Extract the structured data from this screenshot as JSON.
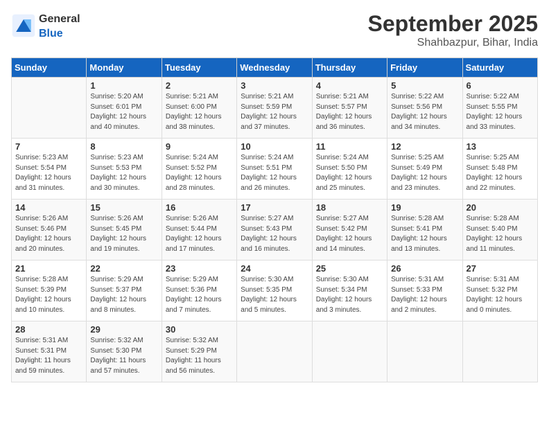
{
  "header": {
    "logo_general": "General",
    "logo_blue": "Blue",
    "month": "September 2025",
    "location": "Shahbazpur, Bihar, India"
  },
  "days_of_week": [
    "Sunday",
    "Monday",
    "Tuesday",
    "Wednesday",
    "Thursday",
    "Friday",
    "Saturday"
  ],
  "weeks": [
    [
      {
        "day": "",
        "sunrise": "",
        "sunset": "",
        "daylight": ""
      },
      {
        "day": "1",
        "sunrise": "5:20 AM",
        "sunset": "6:01 PM",
        "daylight": "12 hours and 40 minutes."
      },
      {
        "day": "2",
        "sunrise": "5:21 AM",
        "sunset": "6:00 PM",
        "daylight": "12 hours and 38 minutes."
      },
      {
        "day": "3",
        "sunrise": "5:21 AM",
        "sunset": "5:59 PM",
        "daylight": "12 hours and 37 minutes."
      },
      {
        "day": "4",
        "sunrise": "5:21 AM",
        "sunset": "5:57 PM",
        "daylight": "12 hours and 36 minutes."
      },
      {
        "day": "5",
        "sunrise": "5:22 AM",
        "sunset": "5:56 PM",
        "daylight": "12 hours and 34 minutes."
      },
      {
        "day": "6",
        "sunrise": "5:22 AM",
        "sunset": "5:55 PM",
        "daylight": "12 hours and 33 minutes."
      }
    ],
    [
      {
        "day": "7",
        "sunrise": "5:23 AM",
        "sunset": "5:54 PM",
        "daylight": "12 hours and 31 minutes."
      },
      {
        "day": "8",
        "sunrise": "5:23 AM",
        "sunset": "5:53 PM",
        "daylight": "12 hours and 30 minutes."
      },
      {
        "day": "9",
        "sunrise": "5:24 AM",
        "sunset": "5:52 PM",
        "daylight": "12 hours and 28 minutes."
      },
      {
        "day": "10",
        "sunrise": "5:24 AM",
        "sunset": "5:51 PM",
        "daylight": "12 hours and 26 minutes."
      },
      {
        "day": "11",
        "sunrise": "5:24 AM",
        "sunset": "5:50 PM",
        "daylight": "12 hours and 25 minutes."
      },
      {
        "day": "12",
        "sunrise": "5:25 AM",
        "sunset": "5:49 PM",
        "daylight": "12 hours and 23 minutes."
      },
      {
        "day": "13",
        "sunrise": "5:25 AM",
        "sunset": "5:48 PM",
        "daylight": "12 hours and 22 minutes."
      }
    ],
    [
      {
        "day": "14",
        "sunrise": "5:26 AM",
        "sunset": "5:46 PM",
        "daylight": "12 hours and 20 minutes."
      },
      {
        "day": "15",
        "sunrise": "5:26 AM",
        "sunset": "5:45 PM",
        "daylight": "12 hours and 19 minutes."
      },
      {
        "day": "16",
        "sunrise": "5:26 AM",
        "sunset": "5:44 PM",
        "daylight": "12 hours and 17 minutes."
      },
      {
        "day": "17",
        "sunrise": "5:27 AM",
        "sunset": "5:43 PM",
        "daylight": "12 hours and 16 minutes."
      },
      {
        "day": "18",
        "sunrise": "5:27 AM",
        "sunset": "5:42 PM",
        "daylight": "12 hours and 14 minutes."
      },
      {
        "day": "19",
        "sunrise": "5:28 AM",
        "sunset": "5:41 PM",
        "daylight": "12 hours and 13 minutes."
      },
      {
        "day": "20",
        "sunrise": "5:28 AM",
        "sunset": "5:40 PM",
        "daylight": "12 hours and 11 minutes."
      }
    ],
    [
      {
        "day": "21",
        "sunrise": "5:28 AM",
        "sunset": "5:39 PM",
        "daylight": "12 hours and 10 minutes."
      },
      {
        "day": "22",
        "sunrise": "5:29 AM",
        "sunset": "5:37 PM",
        "daylight": "12 hours and 8 minutes."
      },
      {
        "day": "23",
        "sunrise": "5:29 AM",
        "sunset": "5:36 PM",
        "daylight": "12 hours and 7 minutes."
      },
      {
        "day": "24",
        "sunrise": "5:30 AM",
        "sunset": "5:35 PM",
        "daylight": "12 hours and 5 minutes."
      },
      {
        "day": "25",
        "sunrise": "5:30 AM",
        "sunset": "5:34 PM",
        "daylight": "12 hours and 3 minutes."
      },
      {
        "day": "26",
        "sunrise": "5:31 AM",
        "sunset": "5:33 PM",
        "daylight": "12 hours and 2 minutes."
      },
      {
        "day": "27",
        "sunrise": "5:31 AM",
        "sunset": "5:32 PM",
        "daylight": "12 hours and 0 minutes."
      }
    ],
    [
      {
        "day": "28",
        "sunrise": "5:31 AM",
        "sunset": "5:31 PM",
        "daylight": "11 hours and 59 minutes."
      },
      {
        "day": "29",
        "sunrise": "5:32 AM",
        "sunset": "5:30 PM",
        "daylight": "11 hours and 57 minutes."
      },
      {
        "day": "30",
        "sunrise": "5:32 AM",
        "sunset": "5:29 PM",
        "daylight": "11 hours and 56 minutes."
      },
      {
        "day": "",
        "sunrise": "",
        "sunset": "",
        "daylight": ""
      },
      {
        "day": "",
        "sunrise": "",
        "sunset": "",
        "daylight": ""
      },
      {
        "day": "",
        "sunrise": "",
        "sunset": "",
        "daylight": ""
      },
      {
        "day": "",
        "sunrise": "",
        "sunset": "",
        "daylight": ""
      }
    ]
  ]
}
